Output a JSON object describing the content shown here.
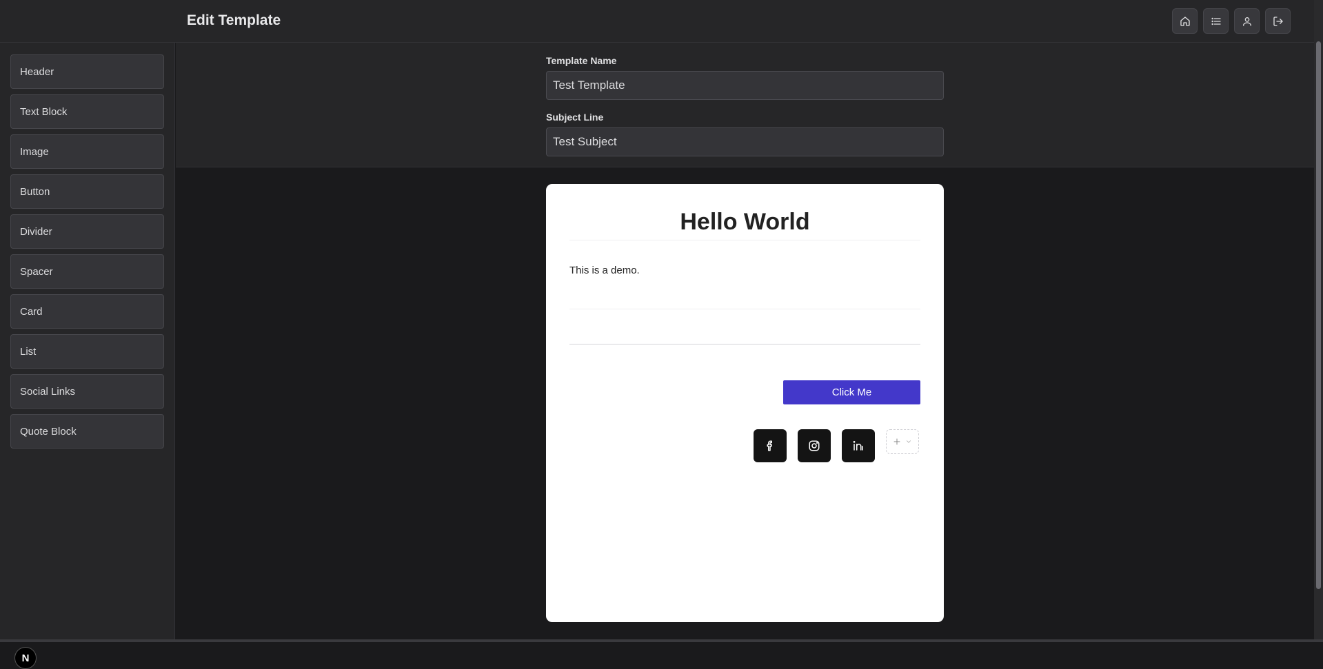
{
  "header": {
    "title": "Edit Template",
    "actions": [
      {
        "icon": "home-icon"
      },
      {
        "icon": "list-icon"
      },
      {
        "icon": "user-icon"
      },
      {
        "icon": "logout-icon"
      }
    ]
  },
  "sidebar": {
    "blocks": [
      {
        "label": "Header"
      },
      {
        "label": "Text Block"
      },
      {
        "label": "Image"
      },
      {
        "label": "Button"
      },
      {
        "label": "Divider"
      },
      {
        "label": "Spacer"
      },
      {
        "label": "Card"
      },
      {
        "label": "List"
      },
      {
        "label": "Social Links"
      },
      {
        "label": "Quote Block"
      }
    ],
    "badge": "N"
  },
  "settings": {
    "template_name_label": "Template Name",
    "template_name_value": "Test Template",
    "subject_label": "Subject Line",
    "subject_value": "Test Subject"
  },
  "canvas": {
    "header_text": "Hello World",
    "body_text": "This is a demo.",
    "button_label": "Click Me",
    "social_links": [
      {
        "icon": "facebook-icon"
      },
      {
        "icon": "instagram-icon"
      },
      {
        "icon": "linkedin-icon"
      }
    ]
  },
  "colors": {
    "accent": "#4338ca",
    "background": "#1a1a1c",
    "panel": "#262628"
  }
}
